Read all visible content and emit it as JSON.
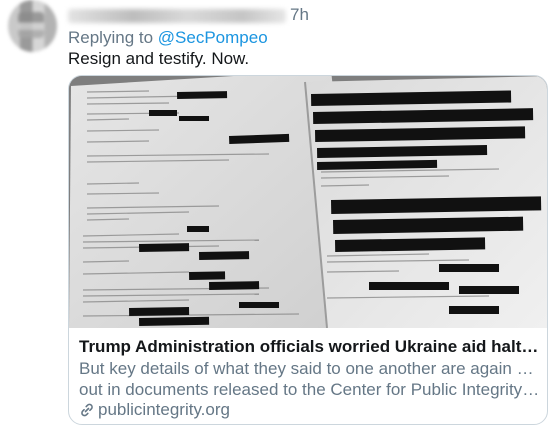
{
  "tweet": {
    "time": "7h",
    "replying_prefix": "Replying to",
    "replying_handle": "@SecPompeo",
    "text": "Resign and testify. Now."
  },
  "card": {
    "title": "Trump Administration officials worried Ukraine aid halt violated s...",
    "description_line1": "But key details of what they said to one another are again blacked",
    "description_line2": "out in documents released to the Center for Public Integrity unde...",
    "domain": "publicintegrity.org",
    "image_icon": "redacted-documents-photo"
  },
  "icons": {
    "link": "link-icon"
  },
  "colors": {
    "link_blue": "#1b95e0",
    "secondary_text": "#657786",
    "primary_text": "#14171a",
    "card_border": "#ccd6dd"
  }
}
